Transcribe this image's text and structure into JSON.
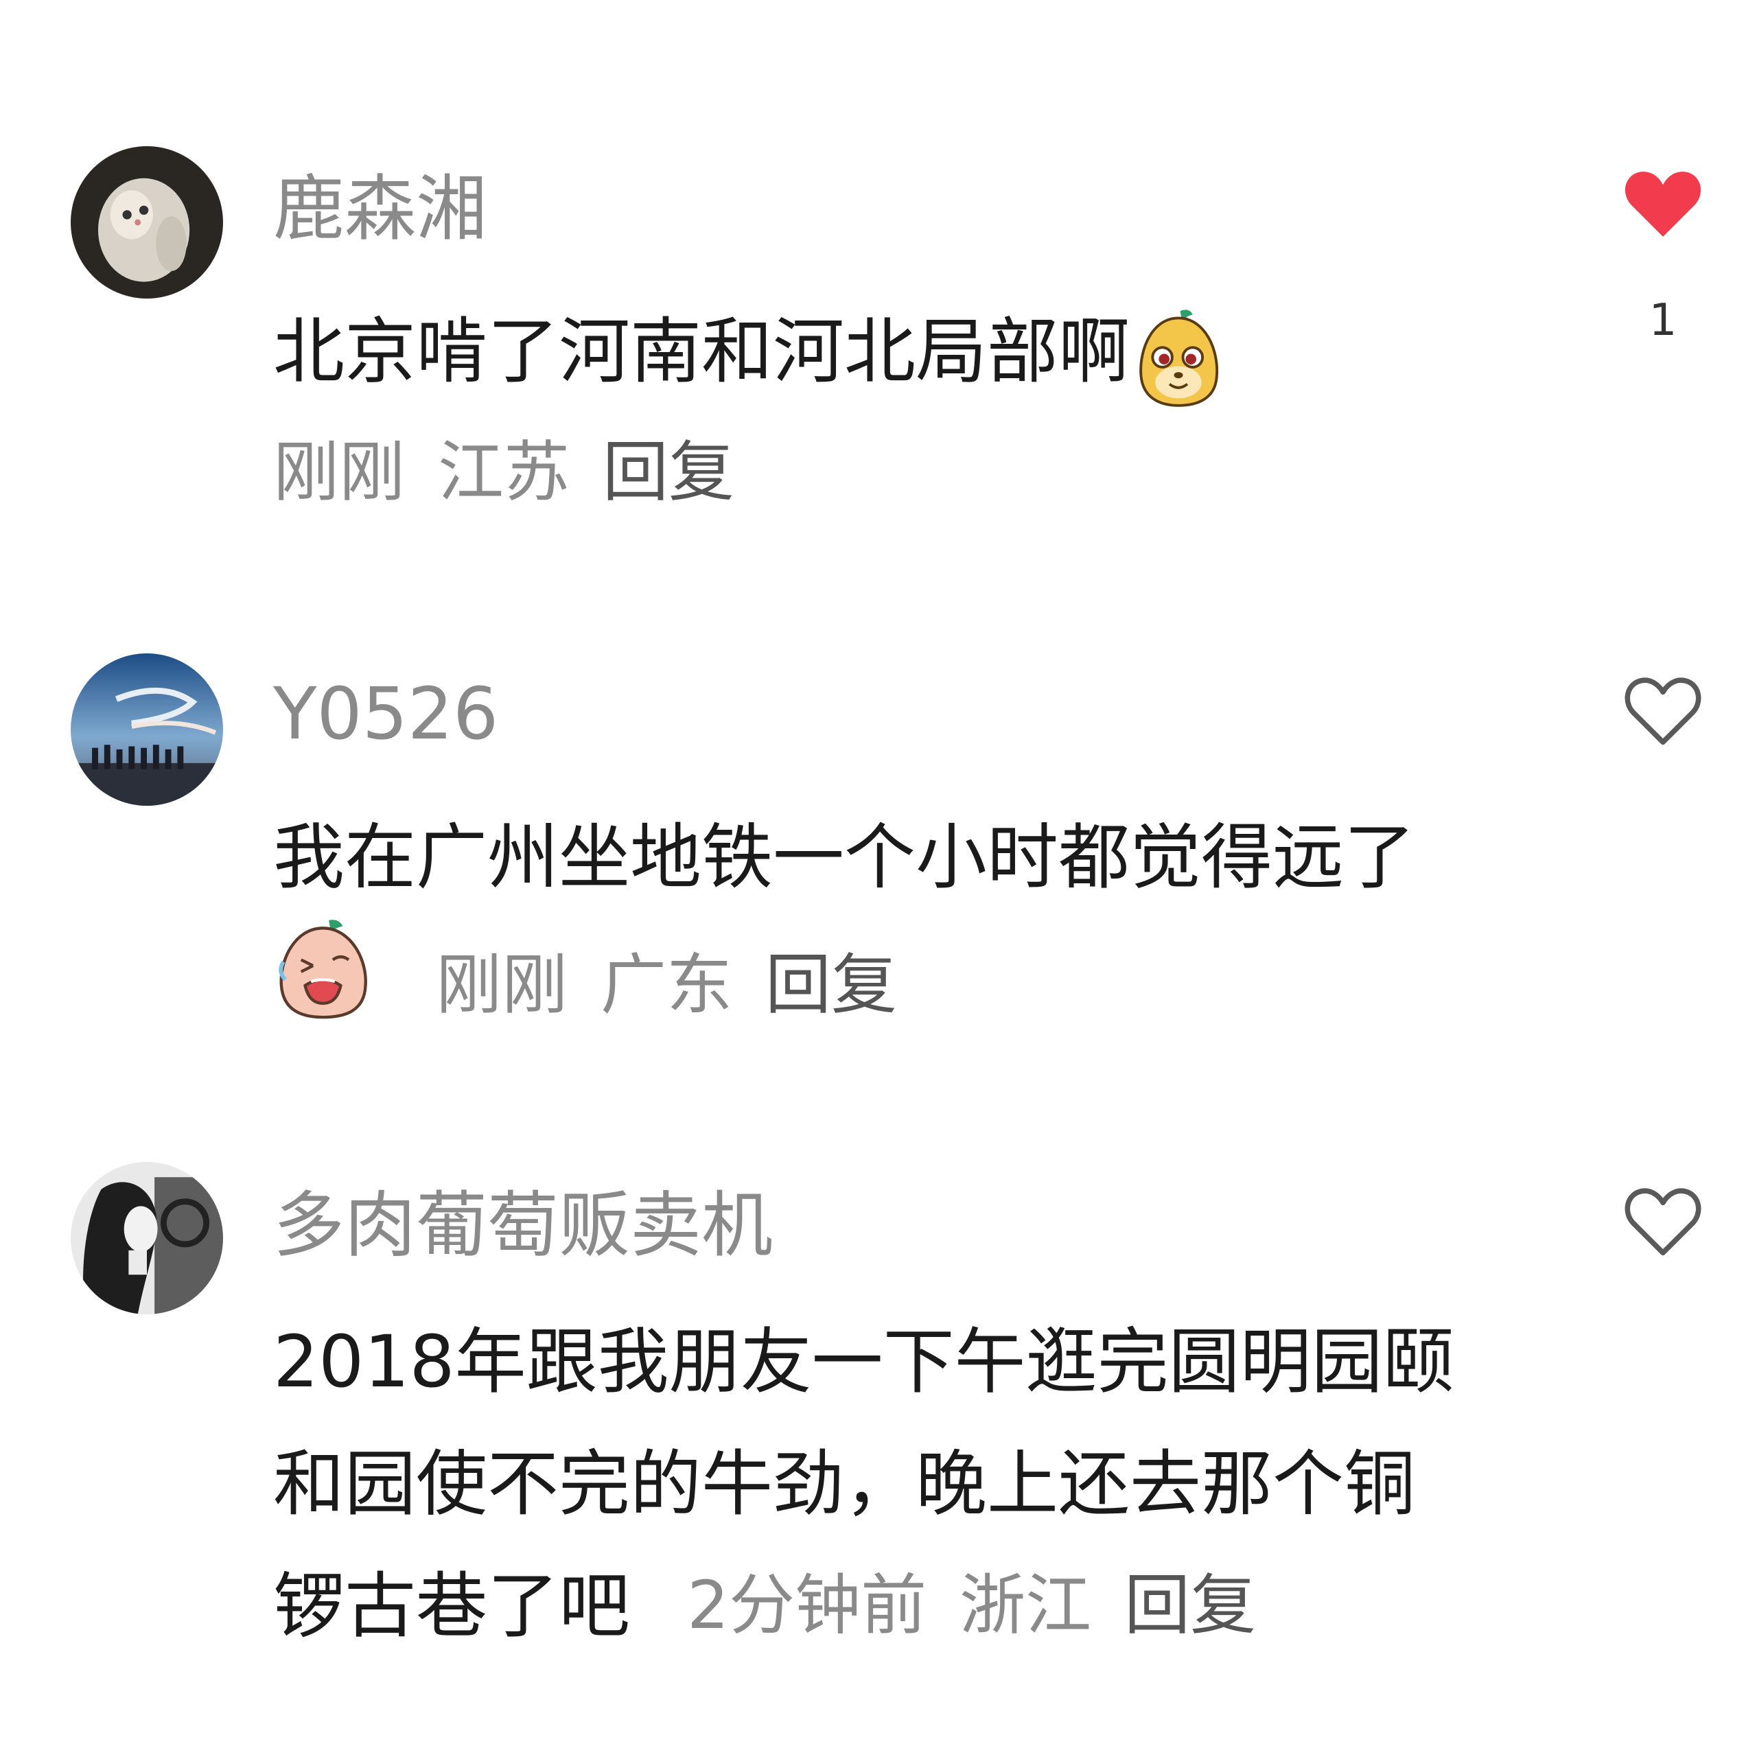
{
  "comments": [
    {
      "username": "鹿森湘",
      "text_lines": [
        "北京啃了河南和河北局部啊"
      ],
      "emoji": "smug-fruit-emoji",
      "time": "刚刚",
      "location": "江苏",
      "reply": "回复",
      "liked": true,
      "like_count": "1",
      "avatar_icon": "cat-avatar"
    },
    {
      "username": "Y0526",
      "text_lines": [
        "我在广州坐地铁一个小时都觉得远了"
      ],
      "emoji": "crying-fruit-emoji",
      "time": "刚刚",
      "location": "广东",
      "reply": "回复",
      "liked": false,
      "like_count": "",
      "avatar_icon": "sky-crowd-avatar"
    },
    {
      "username": "多肉葡萄贩卖机",
      "text_lines": [
        "2018年跟我朋友一下午逛完圆明园颐",
        "和园使不完的牛劲，晚上还去那个铜",
        "锣古巷了吧"
      ],
      "emoji": "",
      "time": "2分钟前",
      "location": "浙江",
      "reply": "回复",
      "liked": false,
      "like_count": "",
      "avatar_icon": "girl-bw-avatar"
    }
  ],
  "colors": {
    "like_active": "#f23c4e",
    "like_inactive": "#5a5a5a",
    "meta": "#8a8a8a"
  }
}
